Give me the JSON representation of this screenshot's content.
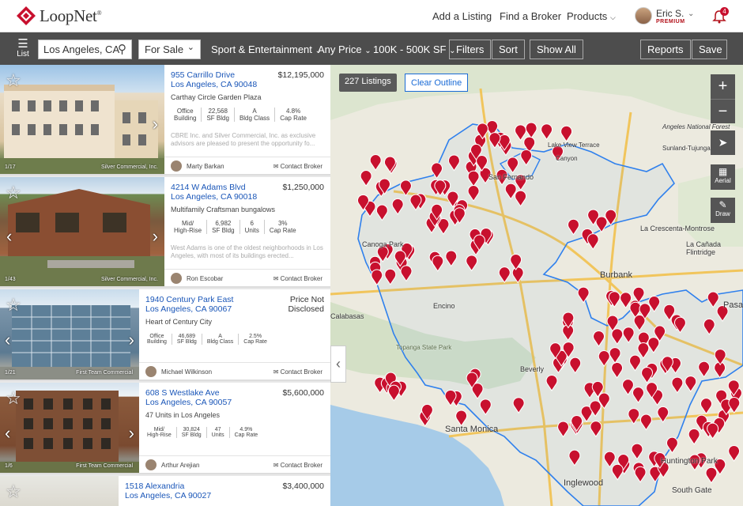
{
  "header": {
    "logo": "LoopNet",
    "trademark": "®",
    "nav": [
      "Add a Listing",
      "Find a Broker",
      "Products"
    ],
    "user_name": "Eric S.",
    "user_tier": "PREMIUM",
    "notifications": "4"
  },
  "toolbar": {
    "list_label": "List",
    "location": "Los Angeles, CA",
    "sale_type": "For Sale",
    "property_type": "Sport & Entertainment",
    "price": "Any Price",
    "size": "100K - 500K SF",
    "filters": "Filters",
    "sort": "Sort",
    "show_all": "Show All",
    "reports": "Reports",
    "save": "Save"
  },
  "listings": [
    {
      "address": "955 Carrillo Drive",
      "city": "Los Angeles, CA 90048",
      "price": "$12,195,000",
      "subtitle": "Carthay Circle Garden Plaza",
      "facts": [
        [
          "Office",
          "Building"
        ],
        [
          "22,568",
          "SF Bldg"
        ],
        [
          "A",
          "Bldg Class"
        ],
        [
          "4.8%",
          "Cap Rate"
        ]
      ],
      "desc": "CBRE Inc. and Silver Commercial, Inc. as exclusive advisors are pleased to present the opportunity fo...",
      "photo_credit": "Silver Commercial, Inc.",
      "photo_count": "1/17",
      "broker": "Marty Barkan",
      "contact": "Contact Broker"
    },
    {
      "address": "4214 W Adams Blvd",
      "city": "Los Angeles, CA 90018",
      "price": "$1,250,000",
      "subtitle": "Multifamily Craftsman bungalows",
      "facts": [
        [
          "Mid/",
          "High-Rise"
        ],
        [
          "6,982",
          "SF Bldg"
        ],
        [
          "6",
          "Units"
        ],
        [
          "3%",
          "Cap Rate"
        ]
      ],
      "desc": "West Adams is one of the oldest neighborhoods in Los Angeles, with most of its buildings erected...",
      "photo_credit": "Silver Commercial, Inc.",
      "photo_count": "1/43",
      "broker": "Ron Escobar",
      "contact": "Contact Broker"
    },
    {
      "address": "1940 Century Park East",
      "city": "Los Angeles, CA 90067",
      "price": "Price Not Disclosed",
      "subtitle": "Heart of Century City",
      "facts": [
        [
          "Office",
          "Building"
        ],
        [
          "46,689",
          "SF Bldg"
        ],
        [
          "A",
          "Bldg Class"
        ],
        [
          "2.5%",
          "Cap Rate"
        ]
      ],
      "desc": "",
      "photo_credit": "First Team Commercial",
      "photo_count": "1/21",
      "broker": "Michael Wilkinson",
      "contact": "Contact Broker"
    },
    {
      "address": "608 S Westlake Ave",
      "city": "Los Angeles, CA 90057",
      "price": "$5,600,000",
      "subtitle": "47 Units in Los Angeles",
      "facts": [
        [
          "Mid/",
          "High-Rise"
        ],
        [
          "30,824",
          "SF Bldg"
        ],
        [
          "47",
          "Units"
        ],
        [
          "4.9%",
          "Cap Rate"
        ]
      ],
      "desc": "",
      "photo_credit": "First Team Commercial",
      "photo_count": "1/6",
      "broker": "Arthur Arejian",
      "contact": "Contact Broker"
    },
    {
      "address": "1518 Alexandria",
      "city": "Los Angeles, CA 90027",
      "price": "$3,400,000",
      "subtitle": "",
      "facts": [],
      "desc": "",
      "photo_credit": "",
      "photo_count": "",
      "broker": "",
      "contact": ""
    }
  ],
  "map": {
    "listing_count": "227 Listings",
    "clear_outline": "Clear Outline",
    "aerial": "Aerial",
    "draw": "Draw",
    "labels": [
      "Angeles National Forest",
      "La Crescenta-Montrose",
      "La Cañada Flintridge",
      "Burbank",
      "San Fernando",
      "Canoga Park",
      "Santa Monica",
      "Huntington Park",
      "Inglewood",
      "South Gate",
      "Topanga State Park",
      "Lake View Terrace",
      "Sunland-Tujunga",
      "Pasa",
      "Calabasas",
      "Canyon",
      "Beverly",
      "Encino"
    ],
    "accent": "#c8102e",
    "boundary_color": "#2f80ed"
  }
}
